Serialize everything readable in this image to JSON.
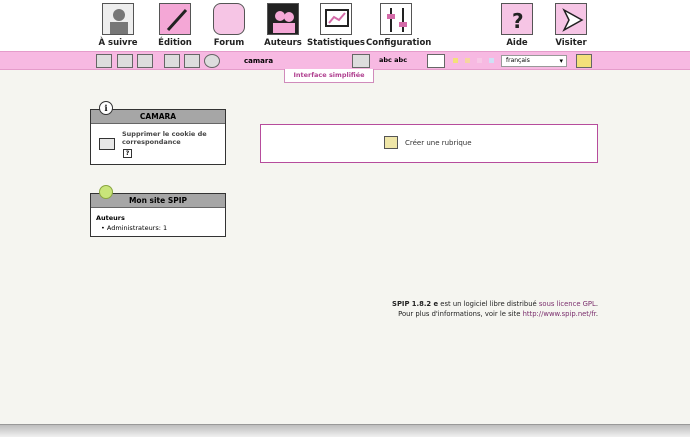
{
  "nav": [
    {
      "label": "À suivre",
      "icon": "person-icon",
      "active": true
    },
    {
      "label": "Édition",
      "icon": "pen-icon"
    },
    {
      "label": "Forum",
      "icon": "speech-bubble-icon"
    },
    {
      "label": "Auteurs",
      "icon": "people-icon"
    },
    {
      "label": "Statistiques",
      "icon": "monitor-chart-icon"
    },
    {
      "label": "Configuration",
      "icon": "sliders-icon"
    },
    {
      "label": "Aide",
      "icon": "question-icon"
    },
    {
      "label": "Visiter",
      "icon": "arrow-icon"
    }
  ],
  "toolbar": {
    "username": "camara",
    "language": "français",
    "interface_tab": "Interface simplifiée"
  },
  "camara_box": {
    "title": "CAMARA",
    "link": "Supprimer le cookie de correspondance",
    "help": "?"
  },
  "site_box": {
    "title": "Mon site SPIP",
    "subtitle": "Auteurs",
    "item": "Administrateurs:  1"
  },
  "create_rubrique": "Créer une rubrique",
  "footer": {
    "product": "SPIP 1.8.2 e",
    "text1": " est un logiciel libre distribué ",
    "license_link": "sous licence GPL",
    "text1_end": ".",
    "text2": "Pour plus d'informations, voir le site ",
    "site_link": "http://www.spip.net/fr",
    "text2_end": "."
  },
  "colors": {
    "pink_bar": "#f7b9e2",
    "accent": "#b64c9c"
  }
}
